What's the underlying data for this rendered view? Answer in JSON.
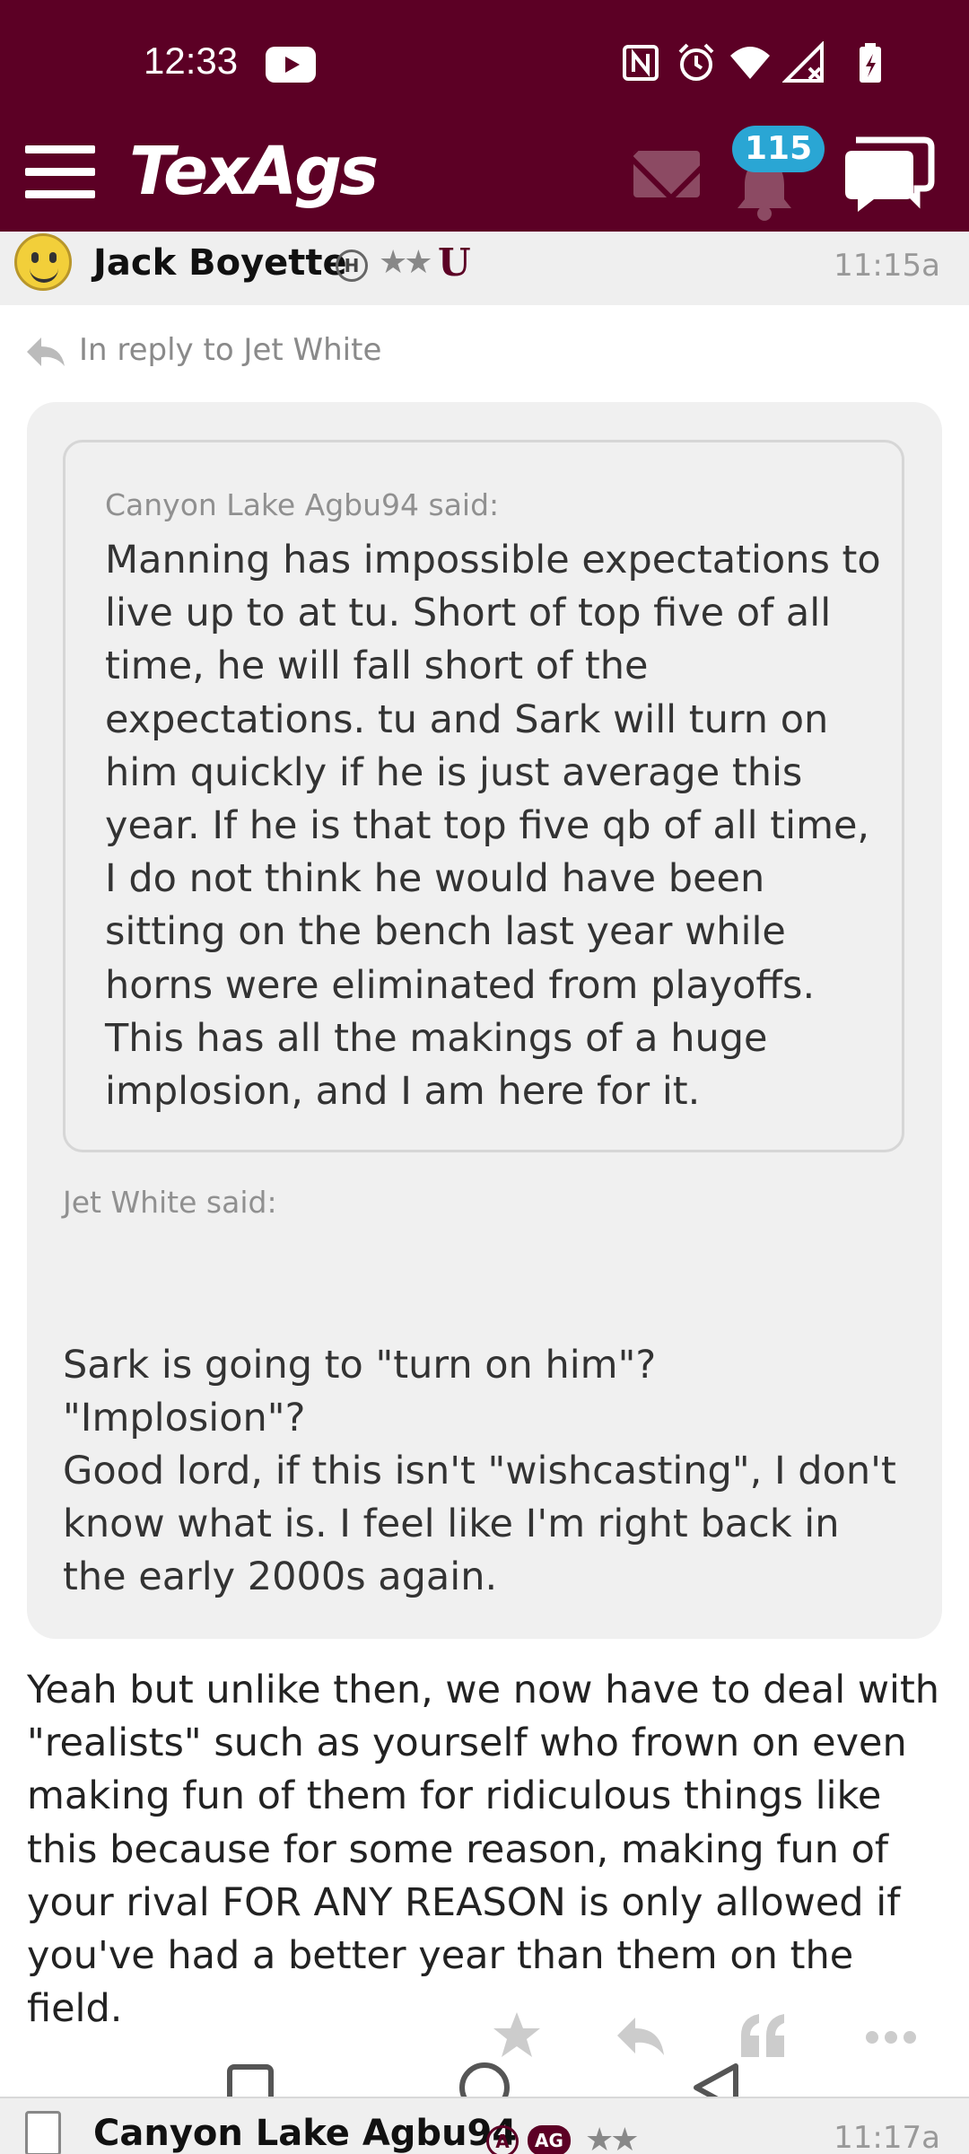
{
  "status_bar": {
    "time": "12:33"
  },
  "app_bar": {
    "logo": "TexAgs",
    "notification_count": "115",
    "brand_color": "#5c0025",
    "badge_color": "#2aa6d4"
  },
  "post": {
    "username": "Jack Boyette",
    "badge_letter": "H",
    "stars": "★★",
    "school_logo": "U",
    "time": "11:15a",
    "reply_to": "In reply to Jet White",
    "quote_inner": {
      "author": "Canyon Lake Agbu94 said:",
      "text": "Manning has impossible expectations to live up to at tu. Short of top five of all time, he will fall short of the expectations. tu and Sark will turn on him quickly if he is just average this year. If he is that top five qb of all time, I do not think he would have been sitting on the bench last year while horns were eliminated from playoffs. This has all the makings of a huge implosion, and I am here for it."
    },
    "quote_outer": {
      "author": "Jet White said:",
      "text1": "Sark is going to \"turn on him\"? \"Implosion\"?",
      "text2": "Good lord, if this isn't \"wishcasting\", I don't know what is. I feel like I'm right back in the early 2000s again."
    },
    "body": "Yeah but unlike then, we now have to deal with \"realists\" such as yourself who frown on even making fun of them for ridiculous things like this because for some reason, making fun of your rival FOR ANY REASON is only allowed if you've had a better year than them on the field."
  },
  "actions": {
    "icons": [
      "star-icon",
      "reply-icon",
      "quote-icon",
      "more-icon"
    ]
  },
  "next_post": {
    "username": "Canyon Lake Agbu94",
    "badge_letter": "A",
    "badge_ag": "AG",
    "stars": "★★",
    "time": "11:17a"
  }
}
